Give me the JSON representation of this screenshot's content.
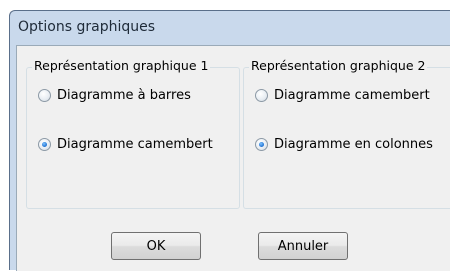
{
  "dialog": {
    "title": "Options graphiques"
  },
  "group1": {
    "legend": "Représentation graphique 1",
    "options": [
      {
        "label": "Diagramme à barres",
        "checked": false
      },
      {
        "label": "Diagramme camembert",
        "checked": true
      }
    ]
  },
  "group2": {
    "legend": "Représentation graphique 2",
    "options": [
      {
        "label": "Diagramme camembert",
        "checked": false
      },
      {
        "label": "Diagramme en colonnes",
        "checked": true
      }
    ]
  },
  "buttons": {
    "ok_label": "OK",
    "cancel_label": "Annuler"
  }
}
